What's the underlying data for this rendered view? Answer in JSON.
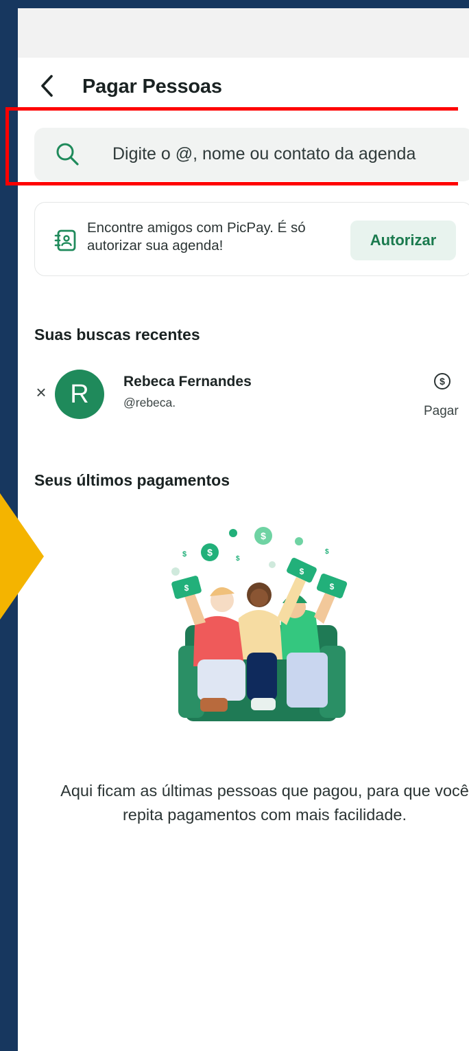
{
  "header": {
    "title": "Pagar Pessoas",
    "back_icon": "chevron-left-icon"
  },
  "search": {
    "placeholder": "Digite o @, nome ou contato da agenda",
    "icon": "search-icon",
    "highlighted": true,
    "highlight_color": "#ff0000"
  },
  "contacts_banner": {
    "icon": "contact-book-icon",
    "text": "Encontre amigos com PicPay. É só autorizar sua agenda!",
    "button_label": "Autorizar"
  },
  "recent_searches": {
    "title": "Suas buscas recentes",
    "items": [
      {
        "initial": "R",
        "name": "Rebeca Fernandes",
        "handle": "@rebeca.",
        "action_label": "Pagar",
        "action_icon": "dollar-circle-icon",
        "remove_icon": "close-icon"
      }
    ]
  },
  "last_payments": {
    "title": "Seus últimos pagamentos",
    "illustration": "people-with-money-illustration",
    "empty_message": "Aqui ficam as últimas pessoas que pagou, para que você repita pagamentos com mais facilidade."
  },
  "colors": {
    "brand_green": "#1f8a5b",
    "button_bg": "#e8f3ee",
    "button_text": "#1a7a4e",
    "page_bg": "#163a66",
    "pointer": "#f4b400"
  }
}
